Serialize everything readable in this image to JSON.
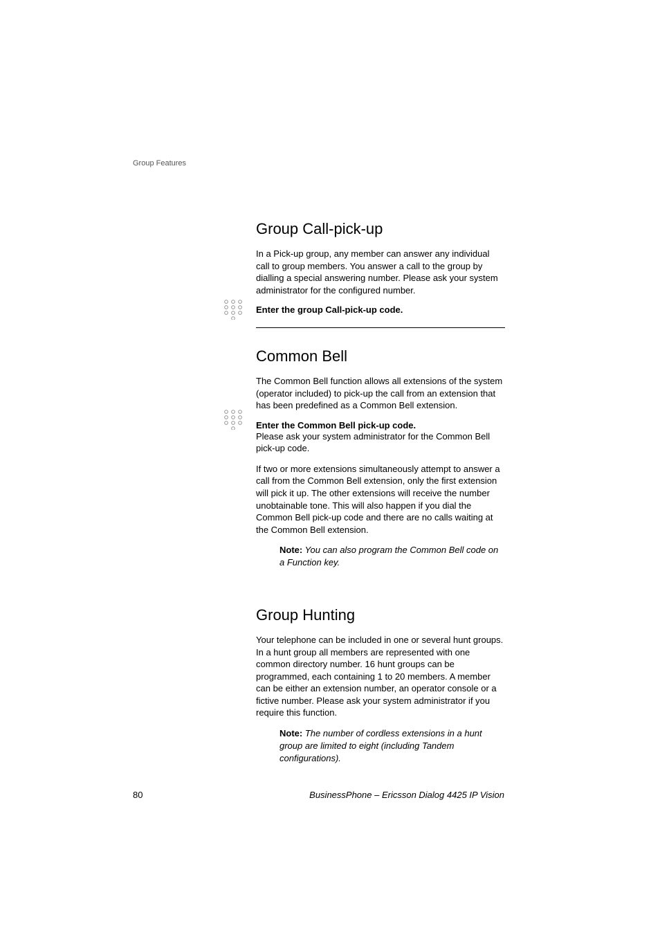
{
  "header": {
    "chapter": "Group Features"
  },
  "sections": {
    "group_call": {
      "title": "Group Call-pick-up",
      "intro": "In a Pick-up group, any member can answer any individual call to group members. You answer a call to the group by dialling a special answering number. Please ask your system administrator for the configured number.",
      "instruction": "Enter the group Call-pick-up code."
    },
    "common_bell": {
      "title": "Common Bell",
      "intro": "The Common Bell function allows all extensions of the system (operator included) to pick-up the call from an extension that has been predefined as a Common Bell extension.",
      "instruction": "Enter the Common Bell pick-up code.",
      "followup": "Please ask your system administrator for the Common Bell pick-up code.",
      "para2": "If two or more extensions simultaneously attempt to answer a call from the Common Bell extension, only the first extension will pick it up. The other extensions will receive the number unobtainable tone. This will also happen if you dial the Common Bell pick-up code and there are no calls waiting at the Common Bell extension.",
      "note_label": "Note:",
      "note_text": " You can also program the Common Bell code on a Function key."
    },
    "group_hunting": {
      "title": "Group Hunting",
      "intro": "Your telephone can be included in one or several hunt groups. In a hunt group all members are represented with one common directory number. 16 hunt groups can be programmed, each containing 1 to 20 members. A member can be either an extension number, an operator console or a fictive number. Please ask your system administrator if you require this function.",
      "note_label": "Note:",
      "note_text": " The number of cordless extensions in a hunt group are limited to eight (including Tandem configurations)."
    }
  },
  "footer": {
    "page_number": "80",
    "doc_title": "BusinessPhone – Ericsson Dialog 4425 IP Vision"
  }
}
